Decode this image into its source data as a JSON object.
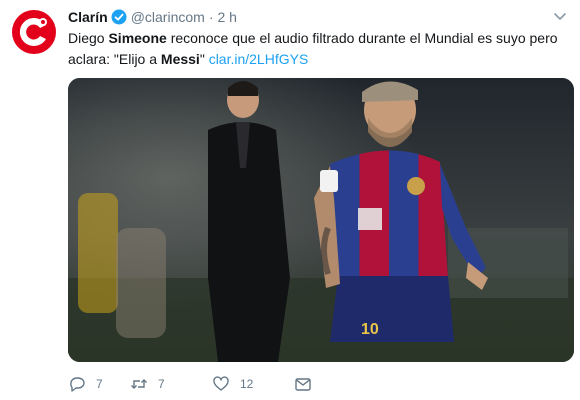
{
  "tweet": {
    "author_name": "Clarín",
    "handle": "@clarincom",
    "separator": "·",
    "time": "2 h",
    "text": {
      "p1": "Diego ",
      "b1": "Simeone",
      "p2": " reconoce que el audio filtrado durante el Mundial es suyo pero aclara: \"Elijo a ",
      "b2": "Messi",
      "p3": "\" ",
      "link": "clar.in/2LHfGYS"
    },
    "media": {
      "jersey_number": "10"
    }
  },
  "actions": {
    "replies": "7",
    "retweets": "7",
    "likes": "12"
  },
  "colors": {
    "brand": "#e3001b",
    "link": "#1da1f2",
    "muted": "#657786",
    "verified": "#1da1f2"
  },
  "icons": [
    "clarin-logo-icon",
    "verified-badge-icon",
    "chevron-down-icon",
    "reply-icon",
    "retweet-icon",
    "like-icon",
    "direct-message-icon"
  ]
}
